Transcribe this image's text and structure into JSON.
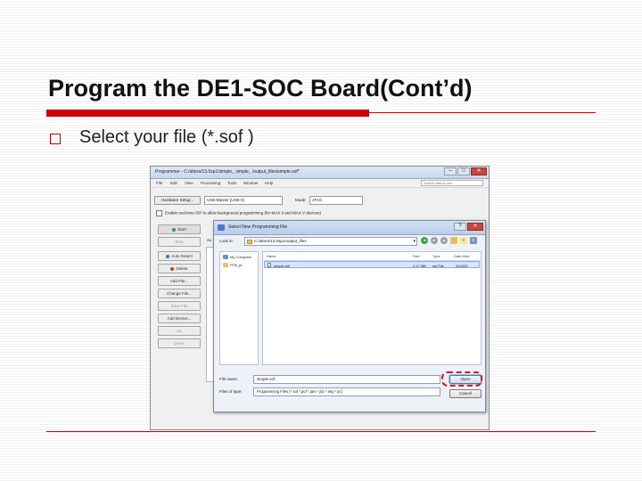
{
  "slide": {
    "title": "Program the DE1-SOC Board(Cont’d)",
    "bullet": "Select your file (*.sof )",
    "accent_color": "#d00000"
  },
  "programmer": {
    "title": "Programmer - C:/altera/13.0sp1/simple_ simple_ /output_files/simple.sof*",
    "menu": [
      "File",
      "Edit",
      "View",
      "Processing",
      "Tools",
      "Window",
      "Help"
    ],
    "search_placeholder": "Search altera.com",
    "hardware_button": "Hardware Setup...",
    "hardware_value": "USB-Blaster [USB-0]",
    "mode_label": "Mode:",
    "mode_value": "JTAG",
    "enable_text": "Enable real-time ISP to allow background programming (for MAX II and MAX V devices)",
    "side_buttons": [
      "Start",
      "Stop",
      "Auto Detect",
      "Delete",
      "Add File...",
      "Change File...",
      "Save File",
      "Add Device...",
      "Up",
      "Down"
    ],
    "partial_tab": "ou"
  },
  "dialog": {
    "title": "Select New Programming File",
    "look_in_label": "Look in:",
    "look_in_value": "C:/altera/13.0sp1/output_files",
    "places": [
      "My Computer",
      "PTB_pt"
    ],
    "columns": [
      "Name",
      "Size",
      "Type",
      "Date Mod"
    ],
    "files": [
      {
        "name": "simple.sof",
        "size": "2.17 MB",
        "type": "sof File",
        "date": "20/10/3"
      }
    ],
    "file_name_label": "File name:",
    "file_name_value": "simple.sof",
    "file_type_label": "Files of type:",
    "file_type_value": "Programming Files (*.sof *.pof *.jam *.jbc *.ekp *.jic)",
    "open_button": "Open",
    "cancel_button": "Cancel"
  }
}
